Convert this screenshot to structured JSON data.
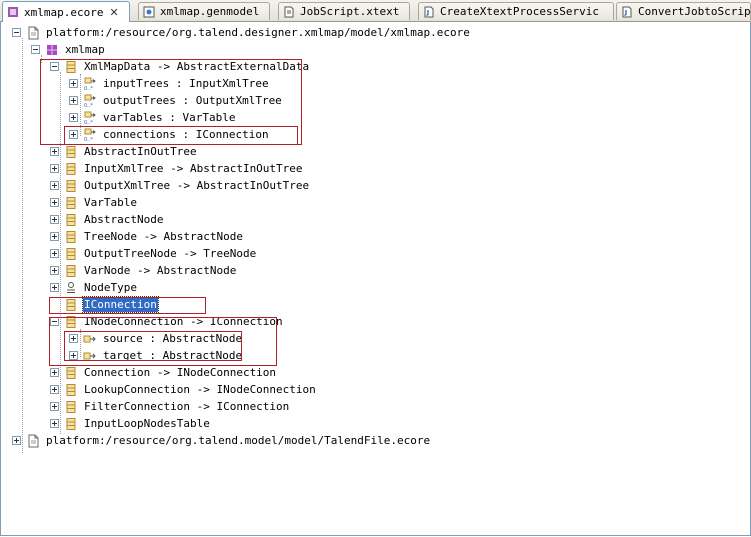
{
  "tabs": [
    {
      "label": "xmlmap.ecore",
      "icon": "ecore-file-icon",
      "active": true,
      "closable": true
    },
    {
      "label": "xmlmap.genmodel",
      "icon": "genmodel-file-icon"
    },
    {
      "label": "JobScript.xtext",
      "icon": "text-file-icon"
    },
    {
      "label": "CreateXtextProcessServic",
      "icon": "java-file-icon"
    },
    {
      "label": "ConvertJobtoScriptH",
      "icon": "java-file-icon"
    }
  ],
  "close_glyph": "✕",
  "tree": [
    {
      "label": "platform:/resource/org.talend.designer.xmlmap/model/xmlmap.ecore",
      "icon": "resource-file-icon"
    },
    {
      "label": "xmlmap",
      "icon": "package-icon"
    },
    {
      "label": "XmlMapData -> AbstractExternalData",
      "icon": "eclass-icon"
    },
    {
      "label": "inputTrees : InputXmlTree",
      "icon": "ereference-icon"
    },
    {
      "label": "outputTrees : OutputXmlTree",
      "icon": "ereference-icon"
    },
    {
      "label": "varTables : VarTable",
      "icon": "ereference-icon"
    },
    {
      "label": "connections : IConnection",
      "icon": "ereference-icon"
    },
    {
      "label": "AbstractInOutTree",
      "icon": "eclass-icon"
    },
    {
      "label": "InputXmlTree -> AbstractInOutTree",
      "icon": "eclass-icon"
    },
    {
      "label": "OutputXmlTree -> AbstractInOutTree",
      "icon": "eclass-icon"
    },
    {
      "label": "VarTable",
      "icon": "eclass-icon"
    },
    {
      "label": "AbstractNode",
      "icon": "eclass-icon"
    },
    {
      "label": "TreeNode -> AbstractNode",
      "icon": "eclass-icon"
    },
    {
      "label": "OutputTreeNode -> TreeNode",
      "icon": "eclass-icon"
    },
    {
      "label": "VarNode -> AbstractNode",
      "icon": "eclass-icon"
    },
    {
      "label": "NodeType",
      "icon": "eenum-icon"
    },
    {
      "label": "IConnection",
      "icon": "eclass-icon",
      "selected": true
    },
    {
      "label": "INodeConnection -> IConnection",
      "icon": "eclass-icon"
    },
    {
      "label": "source : AbstractNode",
      "icon": "eattribute-reference-icon"
    },
    {
      "label": "target : AbstractNode",
      "icon": "eattribute-reference-icon"
    },
    {
      "label": "Connection -> INodeConnection",
      "icon": "eclass-icon"
    },
    {
      "label": "LookupConnection -> INodeConnection",
      "icon": "eclass-icon"
    },
    {
      "label": "FilterConnection -> IConnection",
      "icon": "eclass-icon"
    },
    {
      "label": "InputLoopNodesTable",
      "icon": "eclass-icon"
    },
    {
      "label": "platform:/resource/org.talend.model/model/TalendFile.ecore",
      "icon": "resource-file-icon"
    }
  ],
  "colors": {
    "highlight_box": "#b0202a",
    "selection": "#316ac5"
  }
}
